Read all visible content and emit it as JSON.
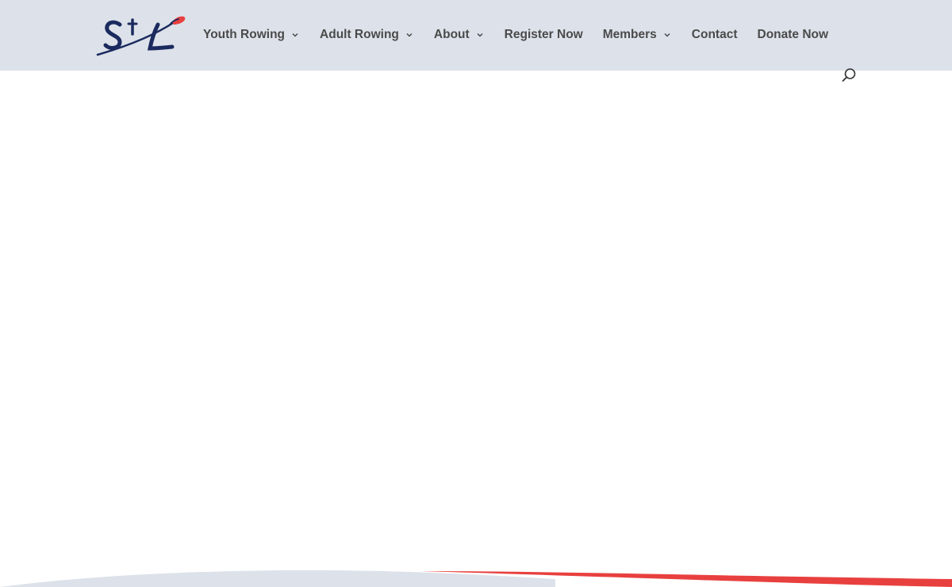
{
  "site": {
    "logo_text": "StL",
    "colors": {
      "header_bg": "#dde2ea",
      "brand_navy": "#1b2a5e",
      "brand_red": "#e8403f",
      "nav_text": "#4a4a4a"
    }
  },
  "nav": {
    "items": [
      {
        "label": "Youth Rowing",
        "has_dropdown": true
      },
      {
        "label": "Adult Rowing",
        "has_dropdown": true
      },
      {
        "label": "About",
        "has_dropdown": true
      },
      {
        "label": "Register Now",
        "has_dropdown": false
      },
      {
        "label": "Members",
        "has_dropdown": true
      },
      {
        "label": "Contact",
        "has_dropdown": false
      },
      {
        "label": "Donate Now",
        "has_dropdown": false
      }
    ],
    "search_icon": "search-icon"
  }
}
